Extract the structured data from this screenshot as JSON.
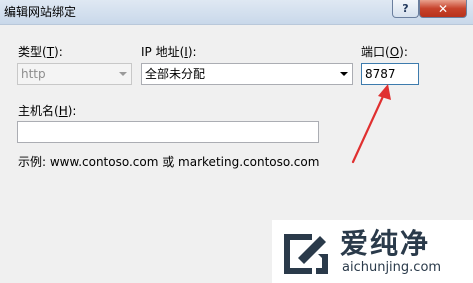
{
  "window": {
    "title": "编辑网站绑定",
    "help_glyph": "?",
    "close_glyph": "✕"
  },
  "form": {
    "type": {
      "label_pre": "类型(",
      "label_key": "T",
      "label_post": "):",
      "value": "http"
    },
    "ip": {
      "label_pre": "IP 地址(",
      "label_key": "I",
      "label_post": "):",
      "value": "全部未分配"
    },
    "port": {
      "label_pre": "端口(",
      "label_key": "O",
      "label_post": "):",
      "value": "8787"
    },
    "hostname": {
      "label_pre": "主机名(",
      "label_key": "H",
      "label_post": "):",
      "value": ""
    },
    "example": "示例: www.contoso.com 或 marketing.contoso.com"
  },
  "watermark": {
    "brand": "爱纯净",
    "url": "aichunjing.com"
  },
  "colors": {
    "arrow": "#e03030",
    "logo": "#2a3a4a"
  }
}
